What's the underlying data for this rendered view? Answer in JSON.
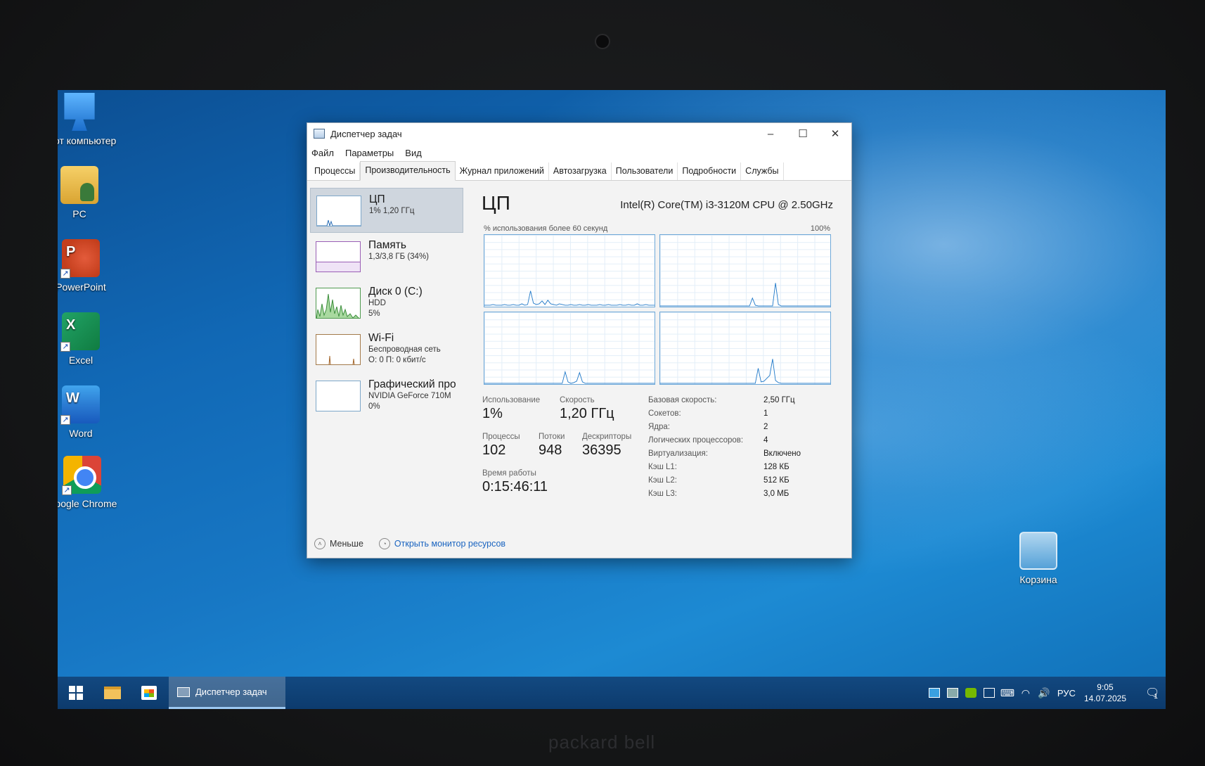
{
  "desktop": {
    "icons": [
      {
        "label": "Этот компьютер"
      },
      {
        "label": "PC"
      },
      {
        "label": "PowerPoint"
      },
      {
        "label": "Excel"
      },
      {
        "label": "Word"
      },
      {
        "label": "Google Chrome"
      }
    ],
    "recycle_bin": {
      "label": "Корзина"
    }
  },
  "window": {
    "title": "Диспетчер задач",
    "menu": [
      "Файл",
      "Параметры",
      "Вид"
    ],
    "tabs": [
      "Процессы",
      "Производительность",
      "Журнал приложений",
      "Автозагрузка",
      "Пользователи",
      "Подробности",
      "Службы"
    ],
    "active_tab": "Производительность"
  },
  "resources": [
    {
      "name": "ЦП",
      "line1": "1% 1,20 ГГц",
      "line2": "",
      "active": true
    },
    {
      "name": "Память",
      "line1": "1,3/3,8 ГБ (34%)",
      "line2": ""
    },
    {
      "name": "Диск 0 (C:)",
      "line1": "HDD",
      "line2": "5%"
    },
    {
      "name": "Wi-Fi",
      "line1": "Беспроводная сеть",
      "line2": "О: 0 П: 0 кбит/с"
    },
    {
      "name": "Графический про",
      "line1": "NVIDIA GeForce 710M",
      "line2": "0%"
    }
  ],
  "cpu": {
    "title": "ЦП",
    "model": "Intel(R) Core(TM) i3-3120M CPU @ 2.50GHz",
    "graph_caption": "% использования более 60 секунд",
    "graph_max": "100%",
    "utilization_label": "Использование",
    "utilization": "1%",
    "speed_label": "Скорость",
    "speed": "1,20 ГГц",
    "processes_label": "Процессы",
    "processes": "102",
    "threads_label": "Потоки",
    "threads": "948",
    "handles_label": "Дескрипторы",
    "handles": "36395",
    "uptime_label": "Время работы",
    "uptime": "0:15:46:11",
    "specs": [
      {
        "key": "Базовая скорость:",
        "value": "2,50 ГГц"
      },
      {
        "key": "Сокетов:",
        "value": "1"
      },
      {
        "key": "Ядра:",
        "value": "2"
      },
      {
        "key": "Логических процессоров:",
        "value": "4"
      },
      {
        "key": "Виртуализация:",
        "value": "Включено"
      },
      {
        "key": "Кэш L1:",
        "value": "128 КБ"
      },
      {
        "key": "Кэш L2:",
        "value": "512 КБ"
      },
      {
        "key": "Кэш L3:",
        "value": "3,0 МБ"
      }
    ],
    "core_usage_percent": [
      [
        2,
        2,
        2,
        3,
        2,
        2,
        2,
        3,
        2,
        2,
        3,
        2,
        2,
        4,
        2,
        3,
        22,
        5,
        3,
        4,
        8,
        3,
        9,
        4,
        3,
        2,
        4,
        3,
        2,
        2,
        3,
        2,
        2,
        3,
        2,
        2,
        3,
        2,
        2,
        2,
        3,
        2,
        2,
        3,
        2,
        2,
        2,
        3,
        2,
        2,
        3,
        2,
        2,
        4,
        2,
        2,
        3,
        2,
        2,
        2
      ],
      [
        1,
        1,
        1,
        1,
        1,
        1,
        1,
        1,
        1,
        1,
        1,
        1,
        1,
        1,
        1,
        1,
        1,
        1,
        1,
        1,
        1,
        1,
        1,
        1,
        1,
        1,
        1,
        1,
        1,
        1,
        1,
        1,
        12,
        2,
        1,
        1,
        1,
        1,
        1,
        1,
        33,
        3,
        1,
        1,
        1,
        1,
        1,
        1,
        1,
        1,
        1,
        1,
        1,
        1,
        1,
        1,
        1,
        1,
        1,
        1
      ],
      [
        1,
        1,
        1,
        1,
        1,
        1,
        1,
        1,
        1,
        1,
        1,
        1,
        1,
        1,
        1,
        1,
        1,
        1,
        1,
        1,
        1,
        1,
        1,
        1,
        1,
        1,
        1,
        1,
        17,
        3,
        1,
        2,
        4,
        16,
        3,
        1,
        1,
        1,
        1,
        1,
        1,
        1,
        1,
        1,
        1,
        1,
        1,
        1,
        1,
        1,
        1,
        1,
        1,
        1,
        1,
        1,
        1,
        1,
        1,
        1
      ],
      [
        1,
        1,
        1,
        1,
        1,
        1,
        1,
        1,
        1,
        1,
        1,
        1,
        1,
        1,
        1,
        1,
        1,
        1,
        1,
        1,
        1,
        1,
        1,
        1,
        1,
        1,
        1,
        1,
        1,
        1,
        1,
        1,
        1,
        1,
        22,
        3,
        4,
        8,
        12,
        35,
        5,
        2,
        1,
        1,
        1,
        1,
        1,
        1,
        1,
        1,
        1,
        1,
        1,
        1,
        1,
        1,
        1,
        1,
        1,
        1
      ]
    ]
  },
  "footer": {
    "less": "Меньше",
    "open_monitor": "Открыть монитор ресурсов"
  },
  "taskbar": {
    "active_app": "Диспетчер задач",
    "lang": "РУС",
    "time": "9:05",
    "date": "14.07.2025",
    "notifications": "1"
  },
  "brand": "packard bell"
}
